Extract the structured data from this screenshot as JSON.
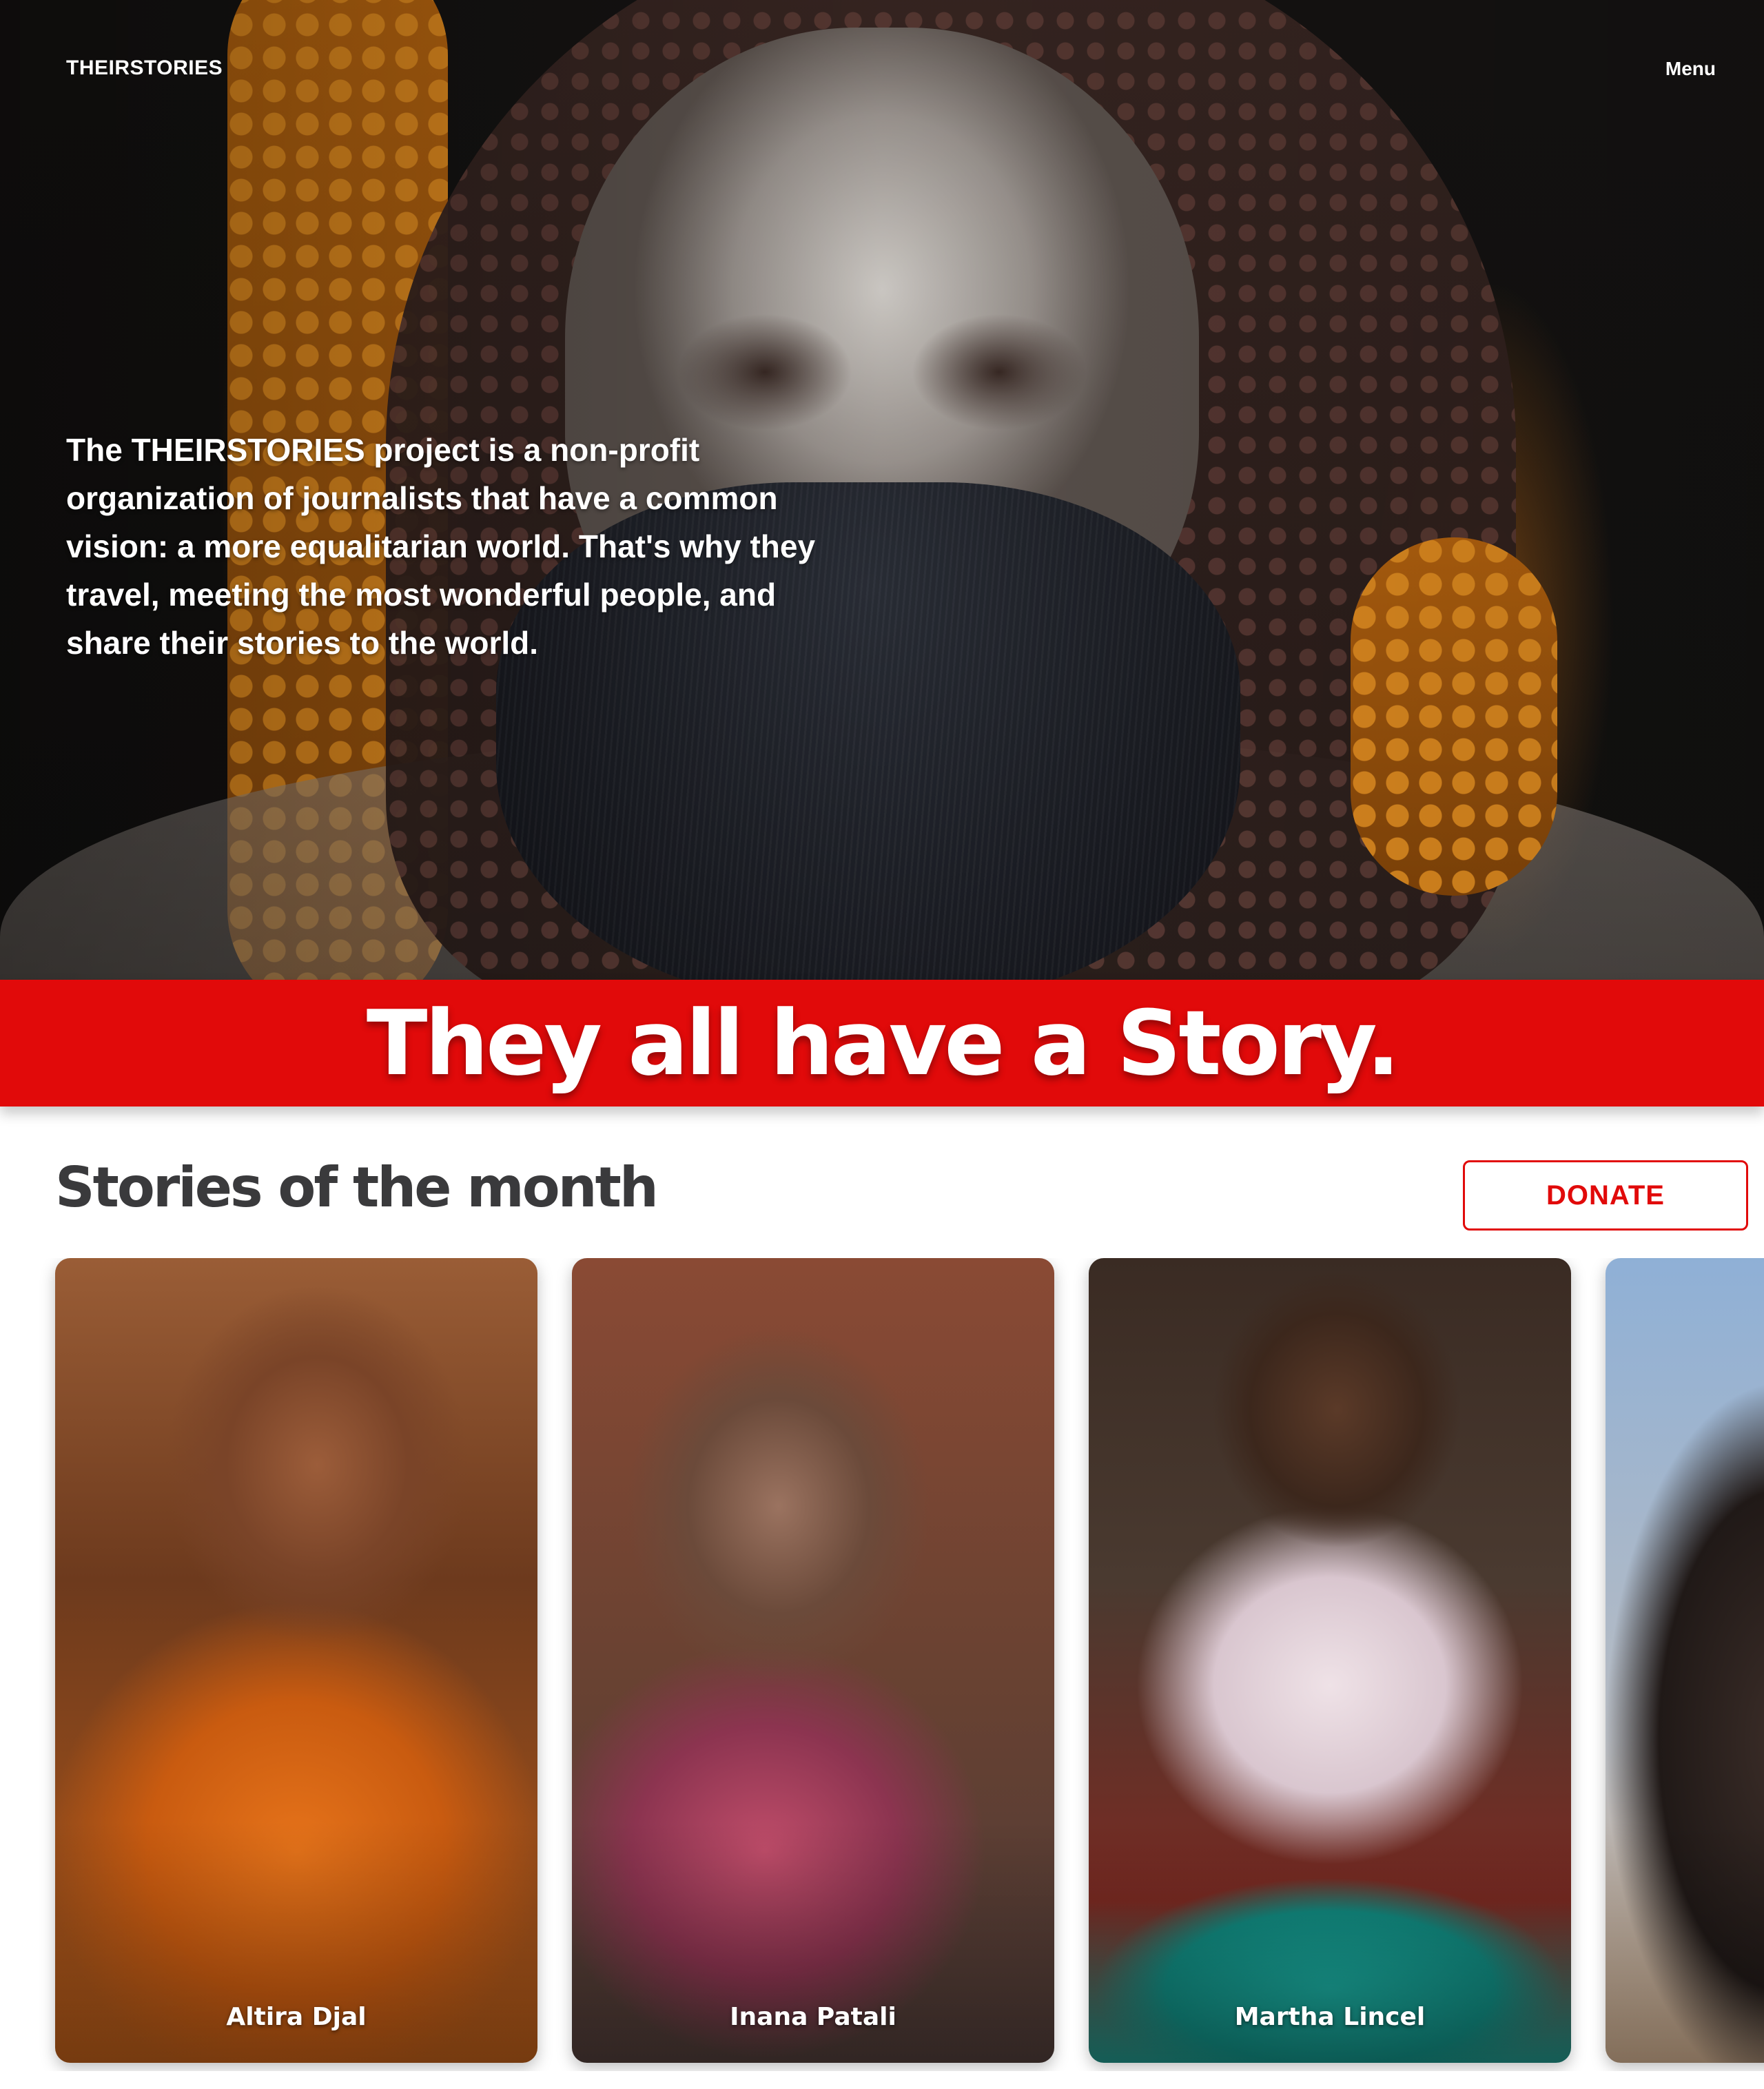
{
  "header": {
    "brand": "THEIRSTORIES",
    "menu_label": "Menu"
  },
  "hero": {
    "intro_prefix": "The ",
    "intro_brand": "THEIRSTORIES",
    "intro_rest": " project is a non-profit organization of journalists that have a common vision: a more equalitarian world. That's why they travel, meeting the most wonderful people, and share their stories to the world."
  },
  "banner": {
    "text": "They all have a Story."
  },
  "stories": {
    "title": "Stories of the month",
    "donate_label": "DONATE",
    "cards": [
      {
        "name": "Altira Djal"
      },
      {
        "name": "Inana Patali"
      },
      {
        "name": "Martha Lincel"
      },
      {
        "name": ""
      }
    ]
  },
  "colors": {
    "accent": "#e10a0a",
    "title": "#3a3a3c",
    "white": "#ffffff"
  }
}
